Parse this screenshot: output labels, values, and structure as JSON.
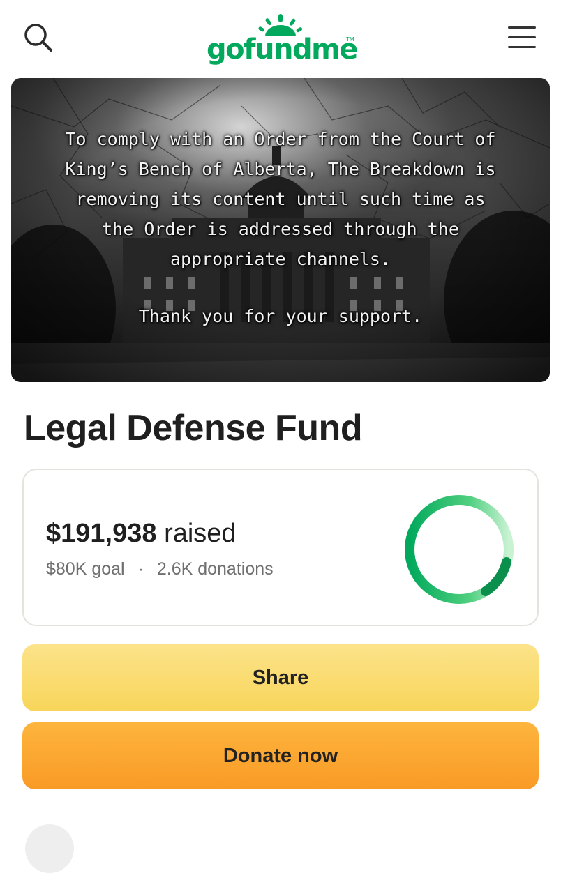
{
  "header": {
    "logo_text": "gofundme",
    "logo_tm": "TM",
    "search_icon": "search-icon",
    "menu_icon": "hamburger-menu-icon",
    "brand_color": "#02a95c"
  },
  "hero": {
    "lines": [
      "To comply with an Order from the Court of",
      "King’s Bench of Alberta, The Breakdown is",
      "removing its content until such time as",
      "the Order is addressed through the",
      "appropriate channels."
    ],
    "thanks": "Thank you for your support."
  },
  "campaign": {
    "title": "Legal Defense Fund"
  },
  "progress": {
    "amount": "$191,938",
    "raised_label": "raised",
    "goal": "$80K goal",
    "separator": "·",
    "donations": "2.6K donations",
    "ring_fraction": 1.0,
    "ring_color": "#02a95c"
  },
  "actions": {
    "share_label": "Share",
    "donate_label": "Donate now",
    "share_color": "#f8d55a",
    "donate_color": "#f99a26"
  }
}
